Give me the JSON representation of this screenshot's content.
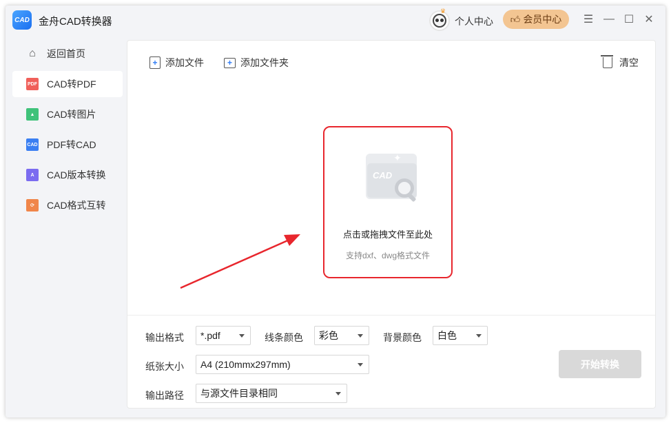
{
  "app": {
    "title": "金舟CAD转换器",
    "logo_text": "CAD"
  },
  "header": {
    "personal_label": "个人中心",
    "vip_label": "会员中心"
  },
  "sidebar": {
    "items": [
      {
        "label": "返回首页",
        "icon": "home-icon",
        "color": "#555555"
      },
      {
        "label": "CAD转PDF",
        "icon": "pdf-file-icon",
        "color": "#f0605a",
        "badge": "PDF"
      },
      {
        "label": "CAD转图片",
        "icon": "image-file-icon",
        "color": "#3fc27a",
        "badge": ""
      },
      {
        "label": "PDF转CAD",
        "icon": "cad-file-icon",
        "color": "#3a7ff2",
        "badge": "CAD"
      },
      {
        "label": "CAD版本转换",
        "icon": "version-file-icon",
        "color": "#7b6cf0",
        "badge": "A"
      },
      {
        "label": "CAD格式互转",
        "icon": "format-file-icon",
        "color": "#f0864a",
        "badge": ""
      }
    ],
    "active_index": 1
  },
  "toolbar": {
    "add_file": "添加文件",
    "add_folder": "添加文件夹",
    "clear": "清空"
  },
  "dropzone": {
    "title": "点击或拖拽文件至此处",
    "subtitle": "支持dxf、dwg格式文件",
    "folder_text": "CAD"
  },
  "settings": {
    "output_format_label": "输出格式",
    "output_format_value": "*.pdf",
    "line_color_label": "线条颜色",
    "line_color_value": "彩色",
    "bg_color_label": "背景颜色",
    "bg_color_value": "白色",
    "paper_size_label": "纸张大小",
    "paper_size_value": "A4 (210mmx297mm)",
    "output_path_label": "输出路径",
    "output_path_value": "与源文件目录相同"
  },
  "actions": {
    "start_label": "开始转换"
  },
  "colors": {
    "accent": "#2f7cf6",
    "highlight_border": "#e8262d",
    "vip_bg": "#f3c592"
  }
}
